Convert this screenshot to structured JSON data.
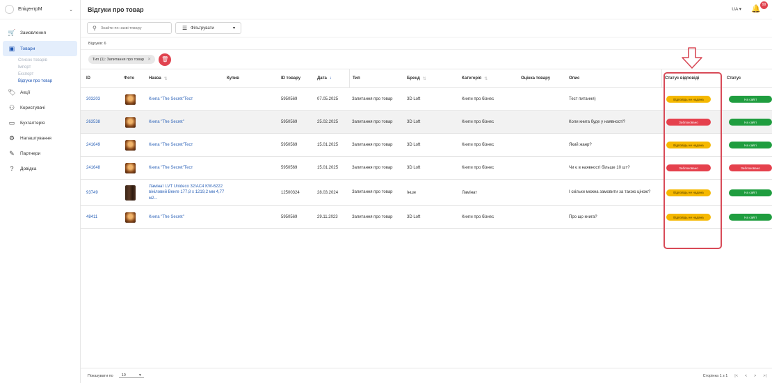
{
  "sidebar": {
    "brand": "ЕпіцентрМ",
    "items": [
      {
        "label": "Замовлення",
        "icon": "cart-icon"
      },
      {
        "label": "Товари",
        "icon": "box-icon",
        "active": true
      },
      {
        "label": "Акції",
        "icon": "tag-icon"
      },
      {
        "label": "Користувачі",
        "icon": "users-icon"
      },
      {
        "label": "Бухгалтерія",
        "icon": "briefcase-icon"
      },
      {
        "label": "Налаштування",
        "icon": "gear-icon"
      },
      {
        "label": "Партнери",
        "icon": "handshake-icon"
      },
      {
        "label": "Довідка",
        "icon": "help-icon"
      }
    ],
    "sub_items": [
      "Список товарів",
      "Імпорт",
      "Експорт",
      "Відгуки про товар"
    ]
  },
  "header": {
    "title": "Відгуки про товар",
    "lang": "UA",
    "notifications": "99"
  },
  "filters": {
    "search_placeholder": "Знайти по назві товару",
    "filter_label": "Фільтрувати"
  },
  "count": "Відгуків: 6",
  "chip": "Тип (1): Запитання про товар",
  "table": {
    "columns": [
      "ID",
      "Фото",
      "Назва",
      "Купив",
      "ID товару",
      "Дата",
      "Тип",
      "Бренд",
      "Категорія",
      "Оцінка товару",
      "Опис",
      "Статус відповіді",
      "Статус"
    ],
    "rows": [
      {
        "id": "303203",
        "photo": "book",
        "name": "Книга \"The Secret\"Тест",
        "buyer": "",
        "product_id": "5950569",
        "date": "07.05.2025",
        "type": "Запитання про товар",
        "brand": "3D Loft",
        "category": "Книги про бізнес",
        "rating": "",
        "description": "Тест питання)",
        "answer_status": "Відповідь не надана",
        "answer_color": "amber",
        "status": "На сайті",
        "status_color": "green"
      },
      {
        "id": "263538",
        "photo": "book",
        "name": "Книга \"The Secret\"",
        "buyer": "",
        "product_id": "5950569",
        "date": "25.02.2025",
        "type": "Запитання про товар",
        "brand": "3D Loft",
        "category": "Книги про бізнес",
        "rating": "",
        "description": "Коли книга буде у наявності?",
        "answer_status": "Заблоковано",
        "answer_color": "red",
        "status": "На сайті",
        "status_color": "green"
      },
      {
        "id": "241649",
        "photo": "book",
        "name": "Книга \"The Secret\"Тест",
        "buyer": "",
        "product_id": "5950569",
        "date": "15.01.2025",
        "type": "Запитання про товар",
        "brand": "3D Loft",
        "category": "Книги про бізнес",
        "rating": "",
        "description": "Який жанр?",
        "answer_status": "Відповідь не надана",
        "answer_color": "amber",
        "status": "На сайті",
        "status_color": "green"
      },
      {
        "id": "241648",
        "photo": "book",
        "name": "Книга \"The Secret\"Тест",
        "buyer": "",
        "product_id": "5950569",
        "date": "15.01.2025",
        "type": "Запитання про товар",
        "brand": "3D Loft",
        "category": "Книги про бізнес",
        "rating": "",
        "description": "Чи є в наявності більше 10 шт?",
        "answer_status": "Заблоковано",
        "answer_color": "red",
        "status": "Заблоковано",
        "status_color": "red"
      },
      {
        "id": "93749",
        "photo": "lam",
        "name": "Ламінат LVT Unideco 32/AC4 KW-6222 вініловий Венге 177,8 х 1219,2 мм 4,77 м2...",
        "buyer": "",
        "product_id": "12500324",
        "date": "28.03.2024",
        "type": "Запитання про товар",
        "brand": "Інше",
        "category": "Ламінат",
        "rating": "",
        "description": "І скільки можна замовити за такою ціною?",
        "answer_status": "Відповідь не надана",
        "answer_color": "amber",
        "status": "На сайті",
        "status_color": "green"
      },
      {
        "id": "48411",
        "photo": "book",
        "name": "Книга \"The Secret\"",
        "buyer": "",
        "product_id": "5950569",
        "date": "29.11.2023",
        "type": "Запитання про товар",
        "brand": "3D Loft",
        "category": "Книги про бізнес",
        "rating": "",
        "description": "Про що книга?",
        "answer_status": "Відповідь не надана",
        "answer_color": "amber",
        "status": "На сайті",
        "status_color": "green"
      }
    ]
  },
  "footer": {
    "per_page_label": "Показувати по",
    "per_page": "10",
    "page_info": "Сторінка 1 з 1"
  },
  "colors": {
    "accent": "#1f56b3",
    "amber": "#f5b800",
    "red": "#e5414d",
    "green": "#1f9d3f",
    "highlight": "#d84a57"
  }
}
